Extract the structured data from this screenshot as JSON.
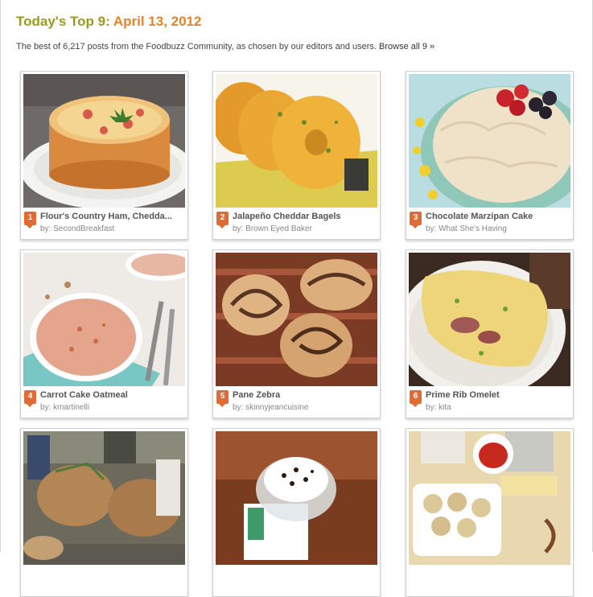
{
  "header": {
    "title_main": "Today's Top 9: ",
    "title_date": "April 13, 2012",
    "subtitle": "The best of 6,217 posts from the Foodbuzz Community, as chosen by our editors and users. ",
    "browse_link": "Browse all 9 »"
  },
  "cards": [
    {
      "rank": "1",
      "title": "Flour's Country Ham, Chedda...",
      "author": "by: SecondBreakfast",
      "image": "quiche-photo"
    },
    {
      "rank": "2",
      "title": "Jalapeño Cheddar Bagels",
      "author": "by: Brown Eyed Baker",
      "image": "bagels-photo"
    },
    {
      "rank": "3",
      "title": "Chocolate Marzipan Cake",
      "author": "by: What She's Having",
      "image": "cake-photo"
    },
    {
      "rank": "4",
      "title": "Carrot Cake Oatmeal",
      "author": "by: kmartinelli",
      "image": "oatmeal-photo"
    },
    {
      "rank": "5",
      "title": "Pane Zebra",
      "author": "by: skinnyjeancuisine",
      "image": "pastry-photo"
    },
    {
      "rank": "6",
      "title": "Prime Rib Omelet",
      "author": "by: kita",
      "image": "omelet-photo"
    },
    {
      "rank": "",
      "title": "",
      "author": "",
      "image": "bread-photo"
    },
    {
      "rank": "",
      "title": "",
      "author": "",
      "image": "chocolate-dessert-photo"
    },
    {
      "rank": "",
      "title": "",
      "author": "",
      "image": "dumplings-photo"
    }
  ]
}
